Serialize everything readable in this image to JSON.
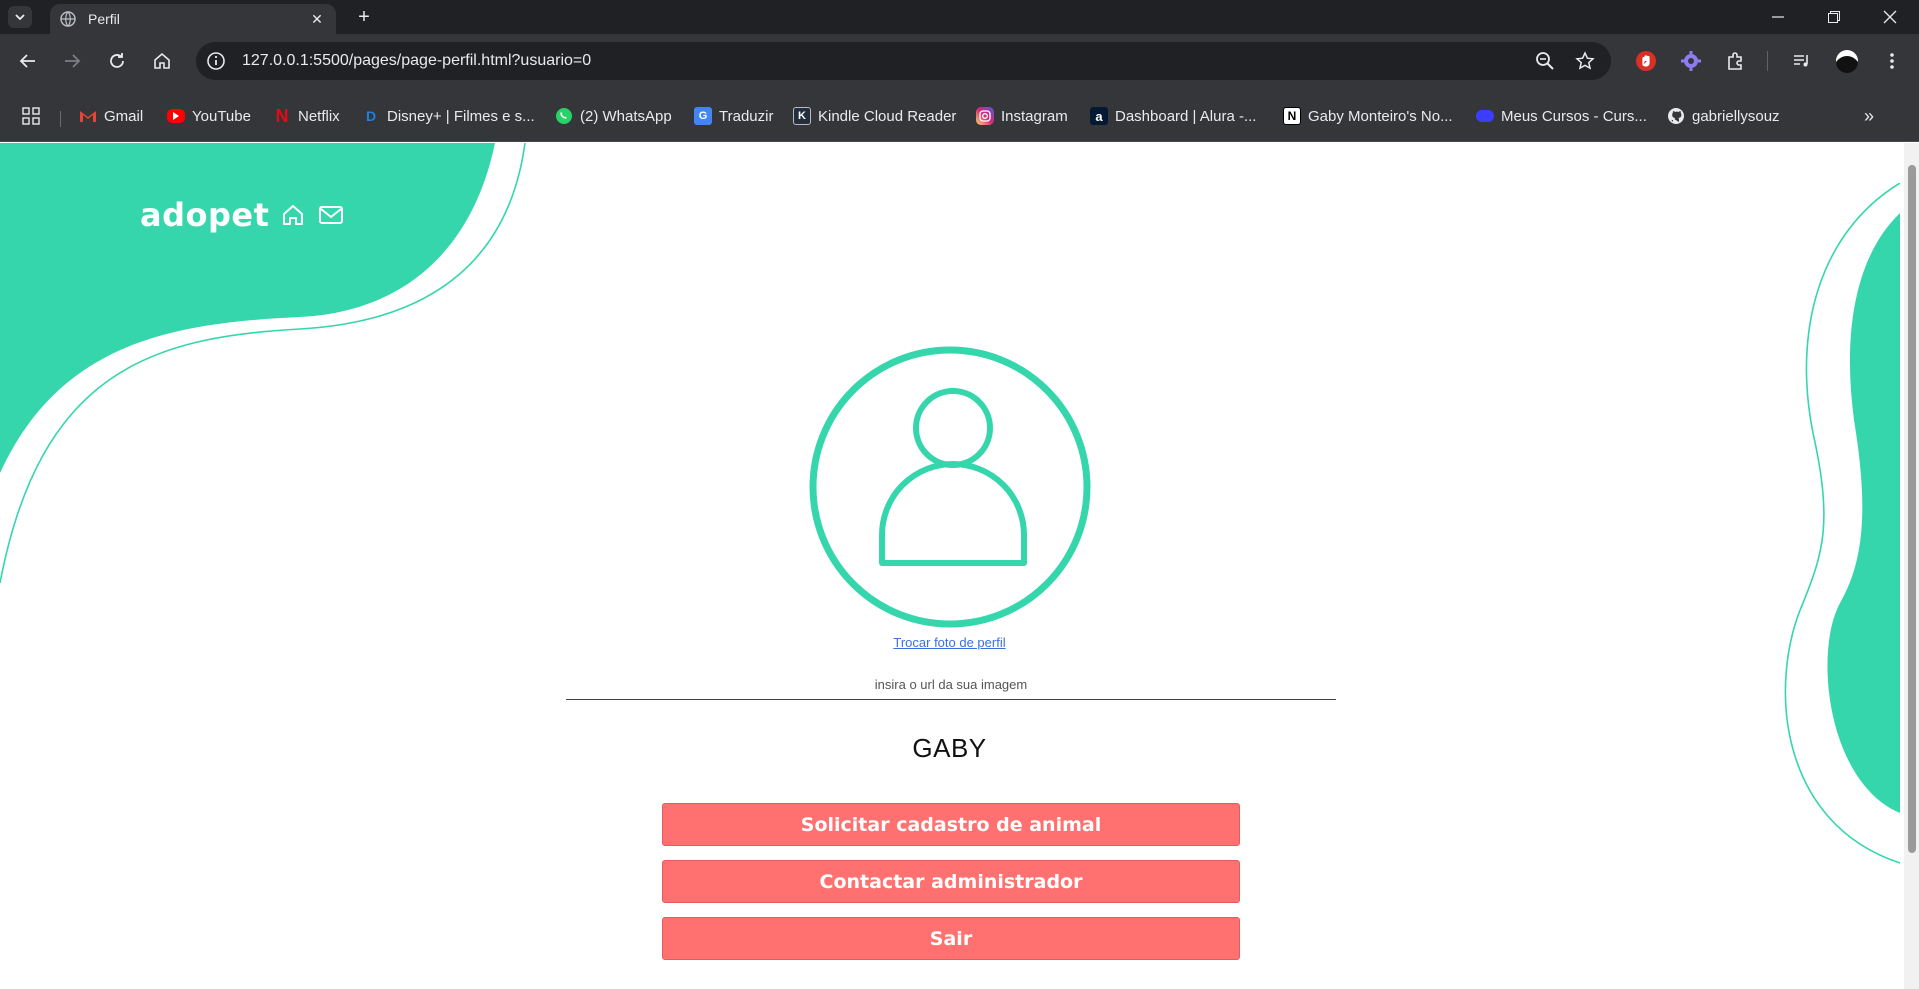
{
  "browser": {
    "tab_title": "Perfil",
    "url": "127.0.0.1:5500/pages/page-perfil.html?usuario=0",
    "bookmarks": [
      {
        "label": "Gmail",
        "icon": "gmail-icon",
        "color": "#ea4335"
      },
      {
        "label": "YouTube",
        "icon": "youtube-icon",
        "color": "#ff0000"
      },
      {
        "label": "Netflix",
        "icon": "netflix-icon",
        "color": "#e50914"
      },
      {
        "label": "Disney+ | Filmes e s...",
        "icon": "disney-icon",
        "color": "#1f80e0"
      },
      {
        "label": "(2) WhatsApp",
        "icon": "whatsapp-icon",
        "color": "#25d366"
      },
      {
        "label": "Traduzir",
        "icon": "translate-icon",
        "color": "#4285f4"
      },
      {
        "label": "Kindle Cloud Reader",
        "icon": "kindle-icon",
        "color": "#232f3e"
      },
      {
        "label": "Instagram",
        "icon": "instagram-icon",
        "color": "#e1306c"
      },
      {
        "label": "Dashboard | Alura -...",
        "icon": "alura-icon",
        "color": "#051933"
      },
      {
        "label": "Gaby Monteiro's No...",
        "icon": "notion-icon",
        "color": "#ffffff"
      },
      {
        "label": "Meus Cursos - Curs...",
        "icon": "courses-icon",
        "color": "#3d3dff"
      },
      {
        "label": "gabriellysouz",
        "icon": "github-icon",
        "color": "#ffffff"
      }
    ]
  },
  "page": {
    "logo": "adopet",
    "change_photo_link": "Trocar foto de perfil",
    "image_url_placeholder": "insira o url da sua imagem",
    "username": "GABY",
    "buttons": {
      "request_animal": "Solicitar cadastro de animal",
      "contact_admin": "Contactar administrador",
      "logout": "Sair"
    },
    "colors": {
      "accent": "#36d6ad",
      "button": "#ff7070",
      "link": "#3b6fe0"
    }
  }
}
